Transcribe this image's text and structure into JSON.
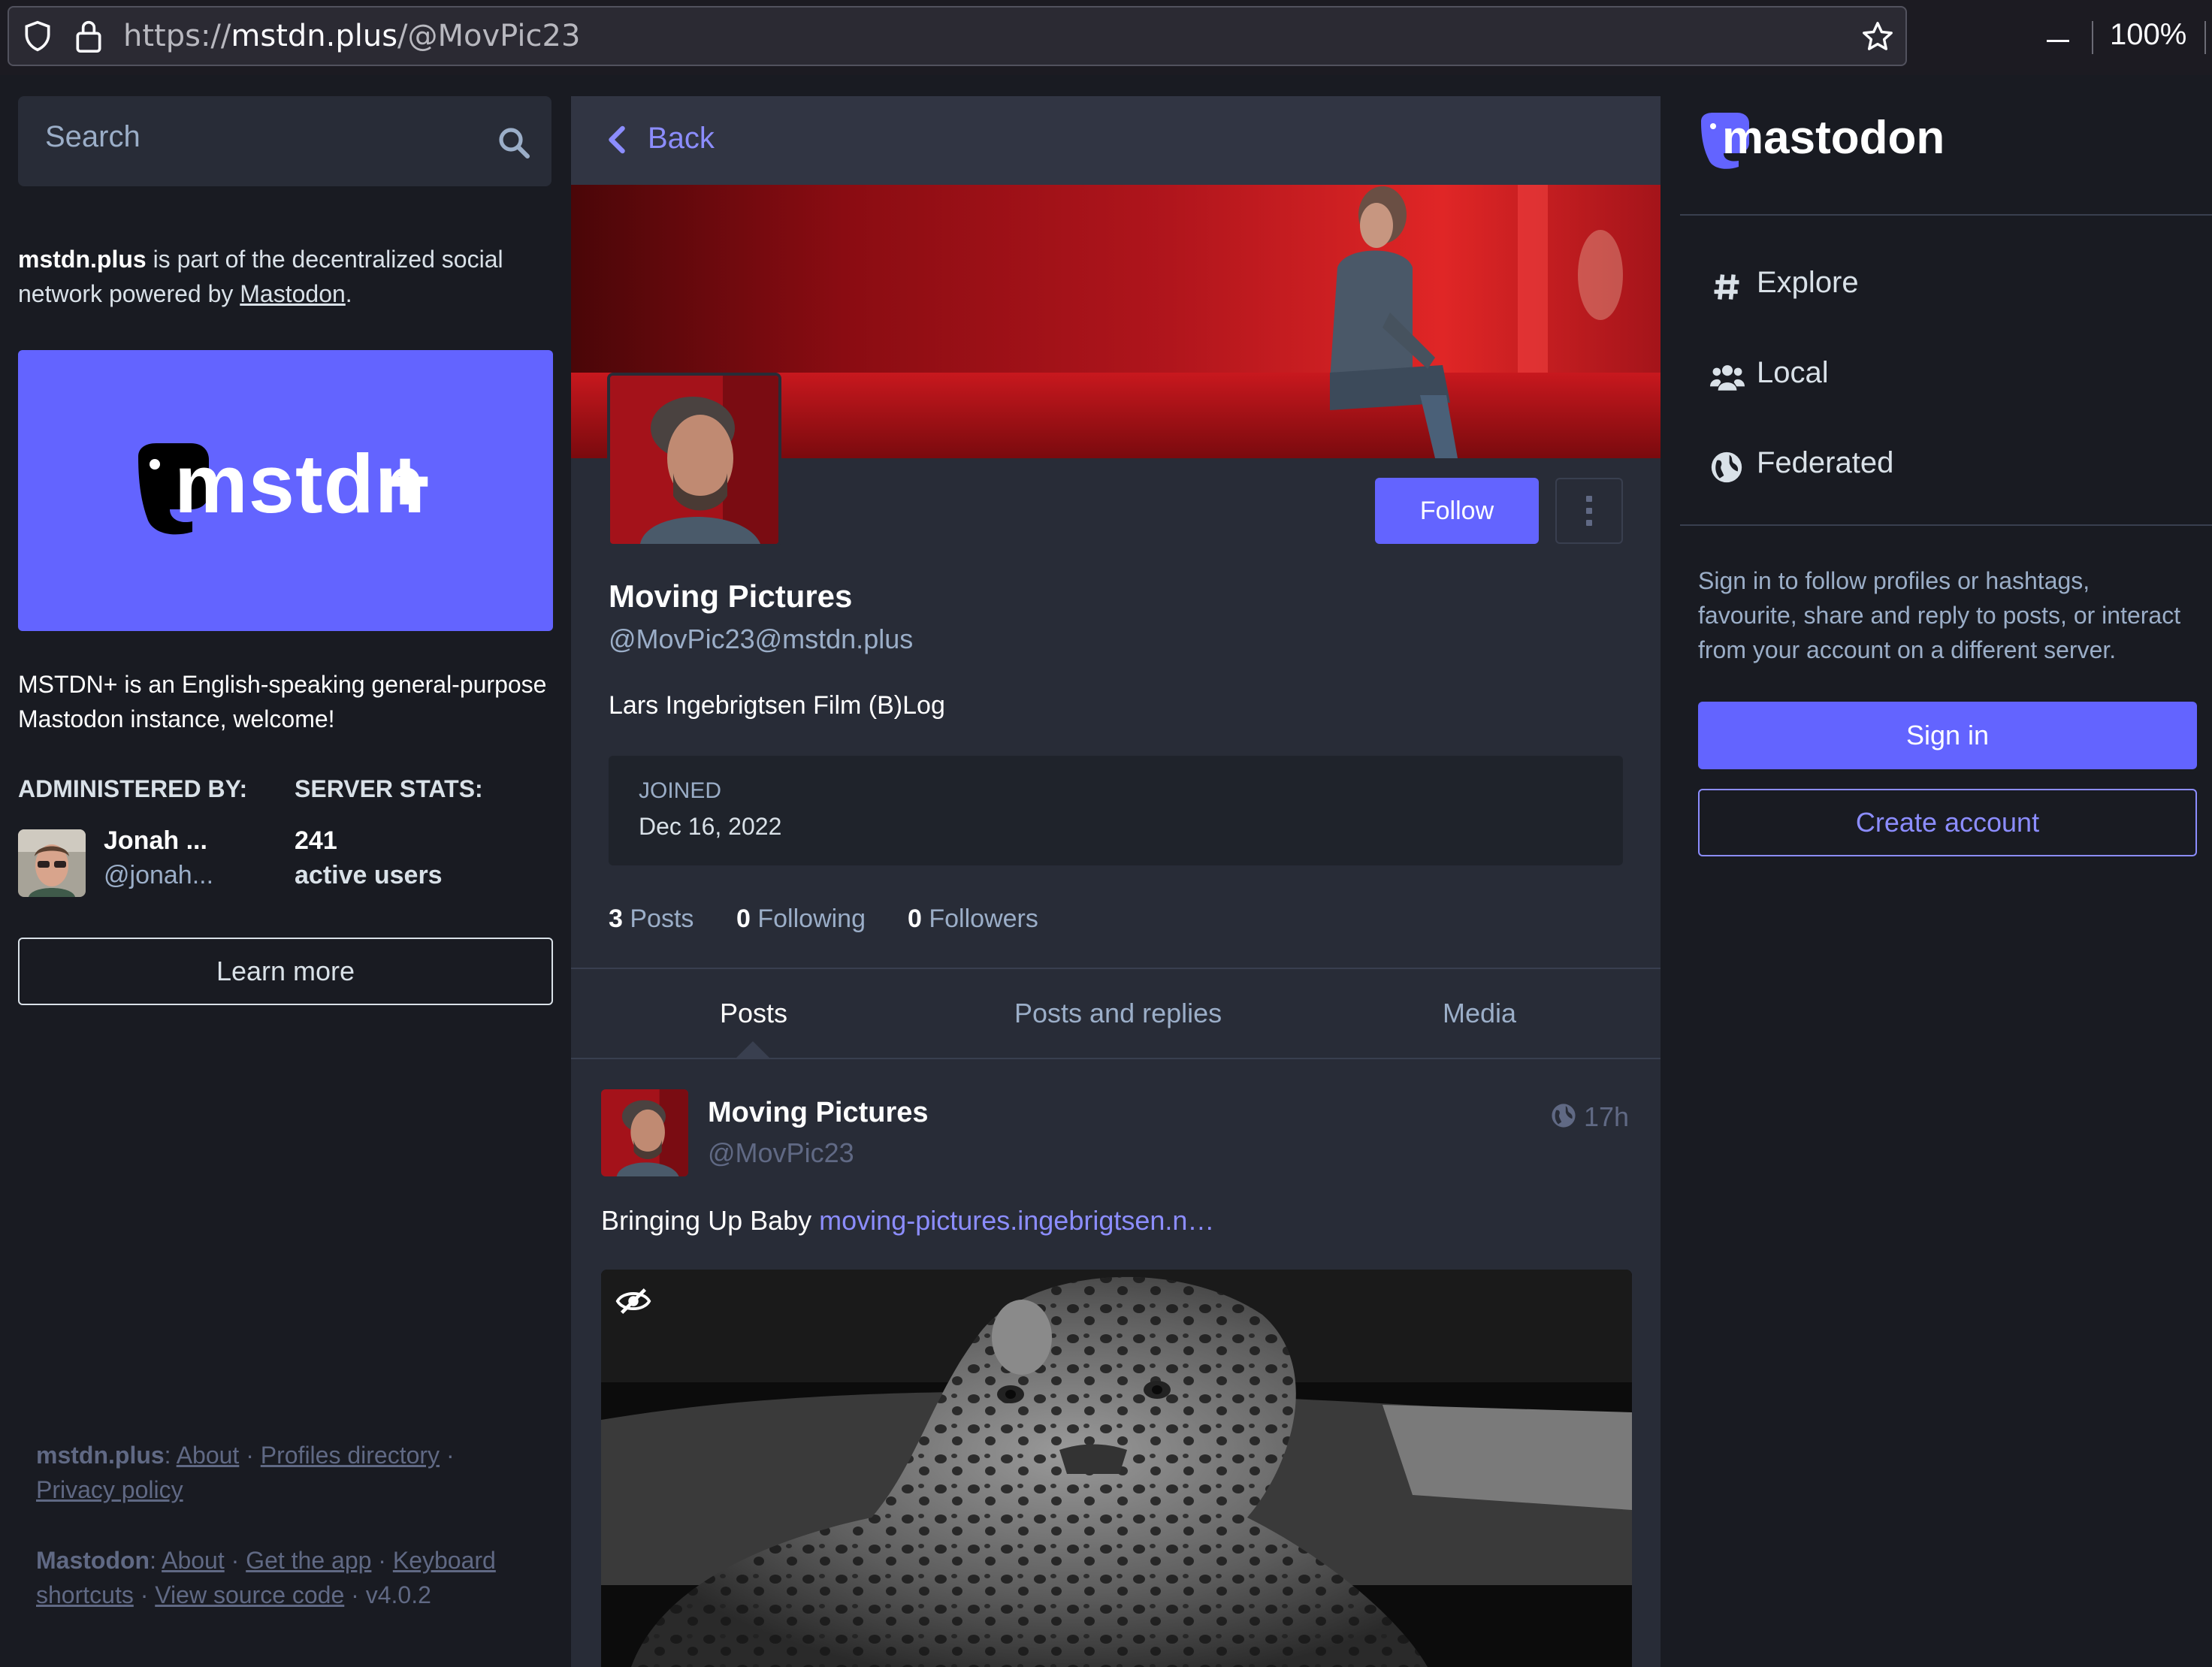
{
  "browser": {
    "url_scheme": "https://",
    "url_host": "mstdn.plus",
    "url_path": "/@MovPic23",
    "zoom": "100%"
  },
  "sidebar_left": {
    "search_placeholder": "Search",
    "intro_server": "mstdn.plus",
    "intro_text": " is part of the decentralized social network powered by ",
    "intro_link": "Mastodon",
    "intro_end": ".",
    "banner_text": "mstdn",
    "banner_plus": "+",
    "description": "MSTDN+ is an English-speaking general-purpose Mastodon instance, welcome!",
    "administered_by_heading": "ADMINISTERED BY:",
    "server_stats_heading": "SERVER STATS:",
    "admin_name": "Jonah ...",
    "admin_handle": "@jonah...",
    "stat_value": "241",
    "stat_label": "active users",
    "learn_more": "Learn more",
    "footer_server": "mstdn.plus",
    "footer_server_links": [
      "About",
      "Profiles directory",
      "Privacy policy"
    ],
    "footer_mastodon": "Mastodon",
    "footer_mastodon_links": [
      "About",
      "Get the app",
      "Keyboard shortcuts",
      "View source code"
    ],
    "version": "v4.0.2"
  },
  "profile": {
    "back_label": "Back",
    "follow_label": "Follow",
    "display_name": "Moving Pictures",
    "acct": "@MovPic23@mstdn.plus",
    "bio": "Lars Ingebrigtsen Film (B)Log",
    "joined_label": "JOINED",
    "joined_date": "Dec 16, 2022",
    "posts_count": "3",
    "posts_label": "Posts",
    "following_count": "0",
    "following_label": "Following",
    "followers_count": "0",
    "followers_label": "Followers",
    "tabs": [
      "Posts",
      "Posts and replies",
      "Media"
    ]
  },
  "post": {
    "author": "Moving Pictures",
    "handle": "@MovPic23",
    "time": "17h",
    "text": "Bringing Up Baby ",
    "link": "moving-pictures.ingebrigtsen.n…"
  },
  "sidebar_right": {
    "logo_text": "mastodon",
    "nav": [
      "Explore",
      "Local",
      "Federated"
    ],
    "signin_prompt": "Sign in to follow profiles or hashtags, favourite, share and reply to posts, or interact from your account on a different server.",
    "signin_label": "Sign in",
    "create_label": "Create account"
  },
  "colors": {
    "accent": "#6364ff",
    "link": "#8c8dff",
    "background": "#191b22",
    "panel": "#282c37"
  }
}
